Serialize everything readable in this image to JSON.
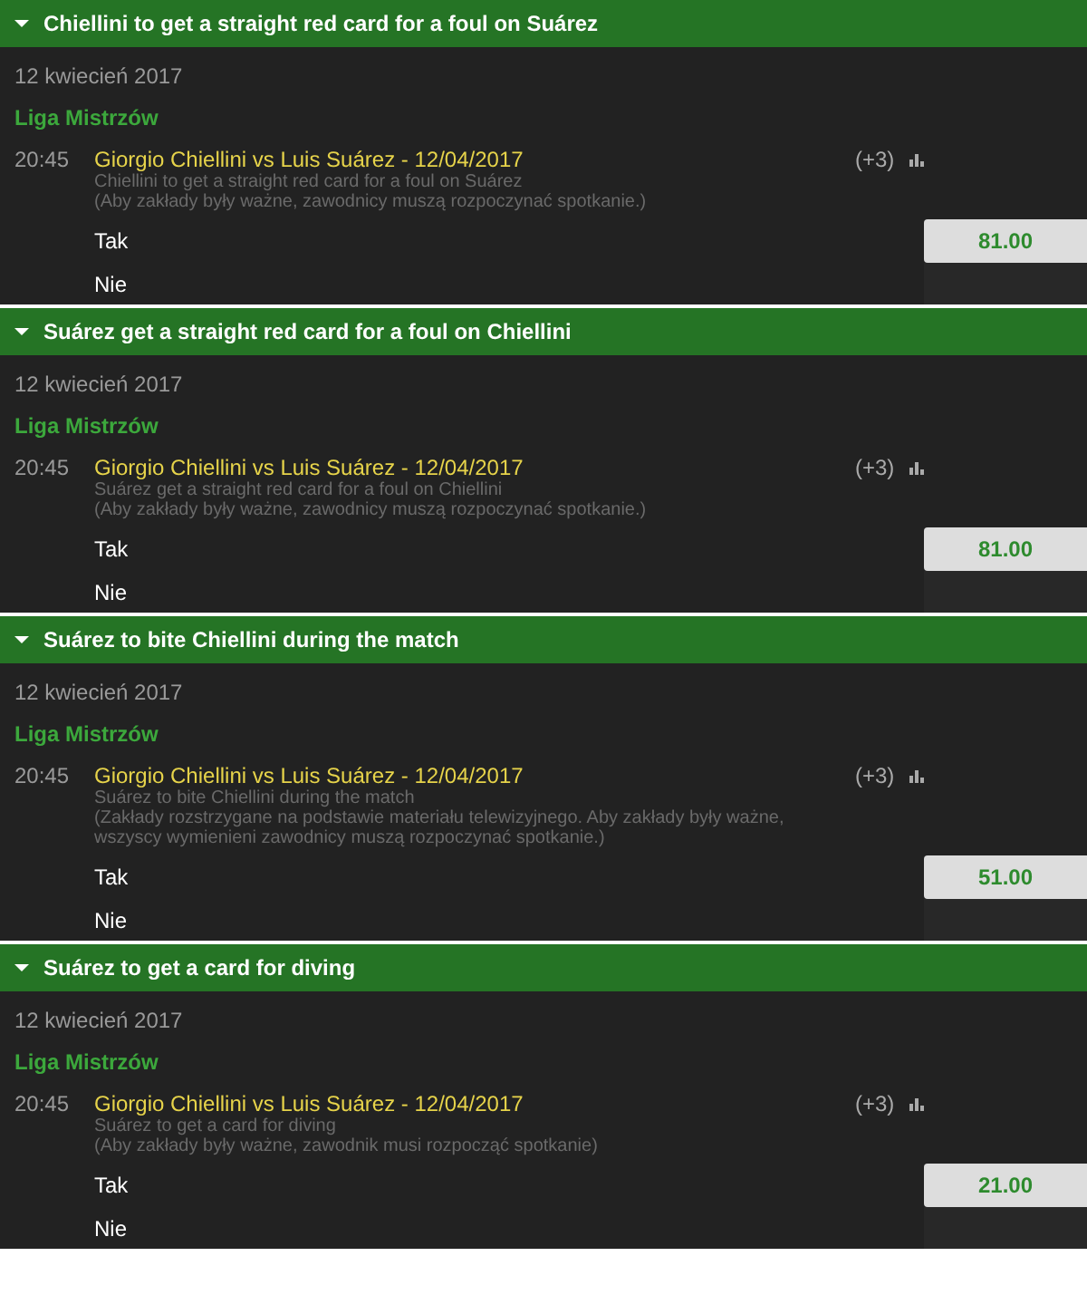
{
  "markets": [
    {
      "title": "Chiellini to get a straight red card for a foul on Suárez",
      "expanded": true,
      "date": "12 kwiecień 2017",
      "league": "Liga Mistrzów",
      "time": "20:45",
      "match": "Giorgio Chiellini vs Luis Suárez - 12/04/2017",
      "more": "(+3)",
      "description": "Chiellini to get a straight red card for a foul on Suárez",
      "note": "(Aby zakłady były ważne, zawodnicy muszą rozpoczynać spotkanie.)",
      "selections": [
        {
          "label": "Tak",
          "odds": "81.00"
        },
        {
          "label": "Nie"
        }
      ]
    },
    {
      "title": "Suárez get a straight red card for a foul on Chiellini",
      "expanded": true,
      "date": "12 kwiecień 2017",
      "league": "Liga Mistrzów",
      "time": "20:45",
      "match": "Giorgio Chiellini vs Luis Suárez - 12/04/2017",
      "more": "(+3)",
      "description": "Suárez get a straight red card for a foul on Chiellini",
      "note": "(Aby zakłady były ważne, zawodnicy muszą rozpoczynać spotkanie.)",
      "selections": [
        {
          "label": "Tak",
          "odds": "81.00"
        },
        {
          "label": "Nie"
        }
      ]
    },
    {
      "title": "Suárez to bite Chiellini during the match",
      "expanded": true,
      "date": "12 kwiecień 2017",
      "league": "Liga Mistrzów",
      "time": "20:45",
      "match": "Giorgio Chiellini vs Luis Suárez - 12/04/2017",
      "more": "(+3)",
      "description": "Suárez to bite Chiellini during the match",
      "note": "(Zakłady rozstrzygane na podstawie materiału telewizyjnego. Aby zakłady były ważne, wszyscy wymienieni zawodnicy muszą rozpoczynać spotkanie.)",
      "selections": [
        {
          "label": "Tak",
          "odds": "51.00"
        },
        {
          "label": "Nie"
        }
      ]
    },
    {
      "title": "Suárez to get a card for diving",
      "expanded": true,
      "date": "12 kwiecień 2017",
      "league": "Liga Mistrzów",
      "time": "20:45",
      "match": "Giorgio Chiellini vs Luis Suárez - 12/04/2017",
      "more": "(+3)",
      "description": "Suárez to get a card for diving",
      "note": "(Aby zakłady były ważne, zawodnik musi rozpocząć spotkanie)",
      "selections": [
        {
          "label": "Tak",
          "odds": "21.00"
        },
        {
          "label": "Nie"
        }
      ]
    }
  ]
}
